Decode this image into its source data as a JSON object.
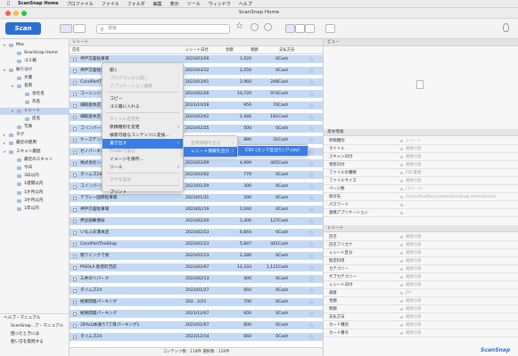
{
  "menubar": {
    "items": [
      "ScanSnap Home",
      "プロファイル",
      "ファイル",
      "フォルダ",
      "編集",
      "表示",
      "ツール",
      "ウィンドウ",
      "ヘルプ"
    ]
  },
  "window": {
    "title": "ScanSnap Home"
  },
  "toolbar": {
    "scan_label": "Scan",
    "search_placeholder": "検索"
  },
  "sidebar": {
    "items": [
      {
        "label": "Mac",
        "indent": 0,
        "twisty": "▾"
      },
      {
        "label": "ScanSnap Home",
        "indent": 1,
        "twisty": ""
      },
      {
        "label": "ゴミ箱",
        "indent": 1,
        "twisty": ""
      },
      {
        "label": "振り分け",
        "indent": 0,
        "twisty": "▾"
      },
      {
        "label": "文書",
        "indent": 1,
        "twisty": ""
      },
      {
        "label": "名刺",
        "indent": 1,
        "twisty": "▾"
      },
      {
        "label": "会社名",
        "indent": 2,
        "twisty": ""
      },
      {
        "label": "氏名",
        "indent": 2,
        "twisty": ""
      },
      {
        "label": "レシート",
        "indent": 1,
        "twisty": "▾"
      },
      {
        "label": "店名",
        "indent": 2,
        "twisty": ""
      },
      {
        "label": "写真",
        "indent": 1,
        "twisty": ""
      },
      {
        "label": "タグ",
        "indent": 0,
        "twisty": "▸"
      },
      {
        "label": "最近の使用",
        "indent": 0,
        "twisty": "▸"
      },
      {
        "label": "スキャン履歴",
        "indent": 0,
        "twisty": "▾"
      },
      {
        "label": "最近のスキャン",
        "indent": 1,
        "twisty": ""
      },
      {
        "label": "今日",
        "indent": 1,
        "twisty": ""
      },
      {
        "label": "3日以内",
        "indent": 1,
        "twisty": ""
      },
      {
        "label": "1週間以内",
        "indent": 1,
        "twisty": ""
      },
      {
        "label": "1か月以内",
        "indent": 1,
        "twisty": ""
      },
      {
        "label": "3か月以内",
        "indent": 1,
        "twisty": ""
      },
      {
        "label": "1年以内",
        "indent": 1,
        "twisty": ""
      }
    ],
    "help": [
      "ヘルプ・マニュアル",
      "ScanSnap...ア・マニュアル",
      "困ったときには",
      "使い方を質問する"
    ]
  },
  "list": {
    "header": "レシート",
    "columns": [
      "店名",
      "レシート日付",
      "金額",
      "税額",
      "支払方法"
    ],
    "rows": [
      {
        "name": "神戸交差駐車場",
        "date": "2023/03/26",
        "amount": "1,020",
        "tax": "0",
        "pay": "Cash",
        "sel": true
      },
      {
        "name": "神戸交差駐車場",
        "date": "2023/03/12",
        "amount": "2,550",
        "tax": "0",
        "pay": "Cash",
        "sel": true
      },
      {
        "name": "CoralPortTheShop",
        "date": "2023/03/01",
        "amount": "2,960",
        "tax": "248",
        "pay": "Cash",
        "sel": true
      },
      {
        "name": "コーニッシュ",
        "date": "2023/02/26",
        "amount": "10,720",
        "tax": "974",
        "pay": "Cash",
        "sel": true
      },
      {
        "name": "細殿屋本店",
        "date": "2023/10/28",
        "amount": "956",
        "tax": "70",
        "pay": "Cash",
        "sel": true
      },
      {
        "name": "細殿屋本店",
        "date": "2023/02/02",
        "amount": "2,446",
        "tax": "181",
        "pay": "Cash",
        "sel": true
      },
      {
        "name": "コインパーキング",
        "date": "2023/02/25",
        "amount": "500",
        "tax": "0",
        "pay": "Cash",
        "sel": true
      },
      {
        "name": "ケーズデンキ 鹿児",
        "date": "2023/02/26",
        "amount": "880",
        "tax": "31",
        "pay": "Cash",
        "sel": true
      },
      {
        "name": "ゼノパーキング",
        "date": "",
        "amount": "",
        "tax": "",
        "pay": "Cash",
        "sel": true
      },
      {
        "name": "株式会社シーズ",
        "date": "2023/03/09",
        "amount": "4,999",
        "tax": "445",
        "pay": "Cash",
        "sel": true
      },
      {
        "name": "タイムズ24",
        "date": "2023/02/02",
        "amount": "770",
        "tax": "0",
        "pay": "Cash",
        "sel": true
      },
      {
        "name": "コインパーキング",
        "date": "2023/01/29",
        "amount": "300",
        "tax": "0",
        "pay": "Cash",
        "sel": true
      },
      {
        "name": "テラシー国際駐車場",
        "date": "2023/01/31",
        "amount": "200",
        "tax": "0",
        "pay": "Cash",
        "sel": true
      },
      {
        "name": "神戸交差駐車場",
        "date": "2023/02/19",
        "amount": "2,040",
        "tax": "0",
        "pay": "Cash",
        "sel": true
      },
      {
        "name": "伊良部郵便局",
        "date": "2023/02/20",
        "amount": "1,400",
        "tax": "127",
        "pay": "Cash",
        "sel": true
      },
      {
        "name": "いなふ天満本店",
        "date": "2023/02/23",
        "amount": "6,844",
        "tax": "0",
        "pay": "Cash",
        "sel": true
      },
      {
        "name": "CoralPortTheShop",
        "date": "2023/02/23",
        "amount": "5,847",
        "tax": "441",
        "pay": "Cash",
        "sel": true
      },
      {
        "name": "親ワイングで焼",
        "date": "2023/02/13",
        "amount": "2,280",
        "tax": "0",
        "pay": "Cash",
        "sel": true
      },
      {
        "name": "PISOLA 能登町百店",
        "date": "2023/02/07",
        "amount": "12,333",
        "tax": "1,121",
        "pay": "Cash",
        "sel": true
      },
      {
        "name": "三井のリパーク",
        "date": "2023/02/13",
        "amount": "400",
        "tax": "0",
        "pay": "Cash",
        "sel": true
      },
      {
        "name": "タイムズ24",
        "date": "2023/01/27",
        "amount": "660",
        "tax": "0",
        "pay": "Cash",
        "sel": true
      },
      {
        "name": "極東開発パーキング",
        "date": "202...2/21",
        "amount": "700",
        "tax": "0",
        "pay": "Cash",
        "sel": true
      },
      {
        "name": "極東開発パーキング",
        "date": "2023/12/07",
        "amount": "600",
        "tax": "0",
        "pay": "Cash",
        "sel": true
      },
      {
        "name": "28%山本通り7丁目パーキング1",
        "date": "2023/01/07",
        "amount": "800",
        "tax": "0",
        "pay": "Cash",
        "sel": true
      },
      {
        "name": "タイムズ24",
        "date": "2023/12/14",
        "amount": "660",
        "tax": "0",
        "pay": "Cash",
        "sel": true
      }
    ],
    "status": "コンテンツ数 : 118件 選択数 : 118件"
  },
  "context_menu": {
    "items": [
      {
        "label": "開く",
        "disabled": false,
        "sub": false
      },
      {
        "label": "プログラムから開く",
        "disabled": true,
        "sub": true
      },
      {
        "label": "アプリケーション連携",
        "disabled": true,
        "sub": true
      },
      {
        "sep": true
      },
      {
        "label": "コピー",
        "disabled": false,
        "sub": false
      },
      {
        "label": "ゴミ箱に入れる",
        "disabled": false,
        "sub": false
      },
      {
        "sep": true
      },
      {
        "label": "タイトル名変更",
        "disabled": true,
        "sub": false
      },
      {
        "label": "原稿種別を変更",
        "disabled": false,
        "sub": true
      },
      {
        "label": "検索可能なコンテンツに変換...",
        "disabled": false,
        "sub": false
      },
      {
        "label": "書き出す",
        "disabled": false,
        "sub": true,
        "highlight": true
      },
      {
        "label": "Finderで表示",
        "disabled": true,
        "sub": false
      },
      {
        "label": "イメージを保存...",
        "disabled": false,
        "sub": false
      },
      {
        "label": "ツール",
        "disabled": false,
        "sub": true
      },
      {
        "sep": true
      },
      {
        "label": "タグを追加",
        "disabled": true,
        "sub": true
      },
      {
        "sep": true
      },
      {
        "label": "プリント",
        "disabled": false,
        "sub": false
      }
    ]
  },
  "submenu1": {
    "items": [
      {
        "label": "名刺情報を出力",
        "disabled": true,
        "sub": true
      },
      {
        "label": "レシート情報を出力",
        "disabled": false,
        "sub": true,
        "highlight": true
      }
    ]
  },
  "submenu2": {
    "items": [
      {
        "label": "CSV (カンマ区切り) (*.csv)",
        "highlight": true
      }
    ]
  },
  "rightpane": {
    "view_title": "ビュー",
    "basic_title": "基本情報",
    "basic": [
      {
        "k": "原稿種別",
        "v": "レシート"
      },
      {
        "k": "タイトル",
        "v": "複数の値"
      },
      {
        "k": "スキャン日付",
        "v": "複数の値"
      },
      {
        "k": "更新日付",
        "v": "複数の値"
      },
      {
        "k": "ファイルの種類",
        "v": "PDF書類"
      },
      {
        "k": "ファイルサイズ",
        "v": "複数の値"
      },
      {
        "k": "ページ数",
        "v": "(1ページ)"
      },
      {
        "k": "保存先",
        "v": "/Users/fsu/Documents/ScanSnap Home/ScanS"
      },
      {
        "k": "パスワード",
        "v": "-"
      },
      {
        "k": "連携アプリケーション",
        "v": "-"
      }
    ],
    "receipt_title": "レシート",
    "receipt": [
      {
        "k": "店名",
        "v": "複数の値"
      },
      {
        "k": "店名フリガナ",
        "v": "複数の値"
      },
      {
        "k": "レシート区分",
        "v": "複数の値"
      },
      {
        "k": "勘定科目",
        "v": "複数の値"
      },
      {
        "k": "カテゴリー",
        "v": "複数の値"
      },
      {
        "k": "サブカテゴリー",
        "v": "複数の値"
      },
      {
        "k": "レシート日付",
        "v": "複数の値"
      },
      {
        "k": "通貨",
        "v": "JPY"
      },
      {
        "k": "金額",
        "v": "複数の値"
      },
      {
        "k": "税額",
        "v": "複数の値"
      },
      {
        "k": "支払方法",
        "v": "複数の値"
      },
      {
        "k": "カード種別",
        "v": "複数の値"
      },
      {
        "k": "カード番号",
        "v": "複数の値"
      }
    ],
    "brand": "ScanSnap"
  },
  "colors": {
    "accent": "#2d6fd1",
    "selection": "#c4d9f3",
    "menu_highlight": "#3b7de4"
  }
}
